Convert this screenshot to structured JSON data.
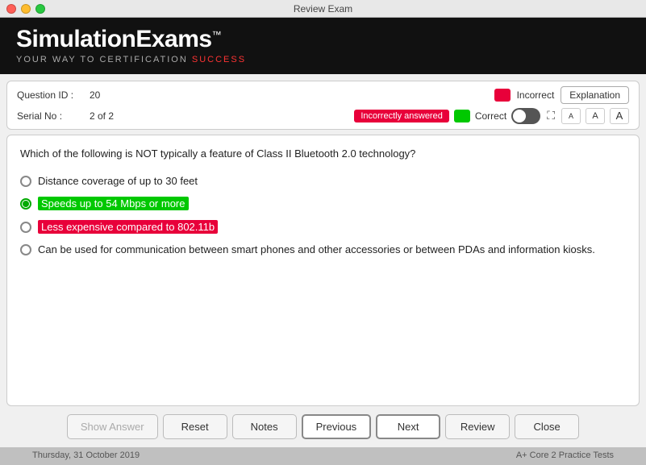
{
  "titleBar": {
    "title": "Review Exam"
  },
  "brand": {
    "name": "SimulationExams",
    "trademark": "™",
    "tagline_part1": "YOUR ",
    "tagline_way": "WAY",
    "tagline_part2": " TO CERTIFICATION ",
    "tagline_success": "SUCCESS"
  },
  "info": {
    "questionIdLabel": "Question ID :",
    "questionIdValue": "20",
    "serialNoLabel": "Serial No :",
    "serialNoValue": "2 of 2",
    "incorrectBadge": "Incorrectly answered",
    "incorrectLabel": "Incorrect",
    "correctLabel": "Correct",
    "explanationBtn": "Explanation"
  },
  "fontButtons": [
    "A",
    "A",
    "A"
  ],
  "question": {
    "text": "Which of the following is NOT typically a feature of Class II Bluetooth 2.0 technology?",
    "options": [
      {
        "id": "opt1",
        "text": "Distance coverage of up to 30 feet",
        "highlight": "none",
        "selected": false
      },
      {
        "id": "opt2",
        "text": "Speeds up to 54 Mbps or more",
        "highlight": "green",
        "selected": true
      },
      {
        "id": "opt3",
        "text": "Less expensive compared to 802.11b",
        "highlight": "red",
        "selected": false
      },
      {
        "id": "opt4",
        "text": "Can be used for communication between smart phones and other accessories or between PDAs and information kiosks.",
        "highlight": "none",
        "selected": false
      }
    ]
  },
  "buttons": {
    "showAnswer": "Show Answer",
    "reset": "Reset",
    "notes": "Notes",
    "previous": "Previous",
    "next": "Next",
    "review": "Review",
    "close": "Close"
  },
  "footer": {
    "date": "Thursday, 31 October 2019",
    "product": "A+ Core 2 Practice Tests"
  }
}
